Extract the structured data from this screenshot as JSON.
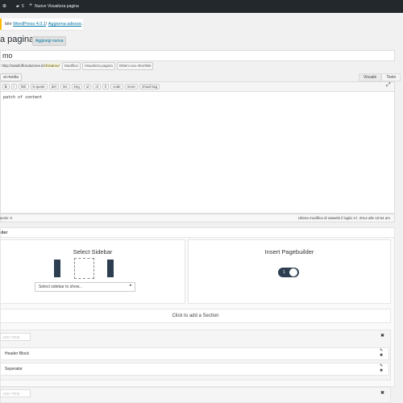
{
  "admin_bar": {
    "comments_count": "5",
    "new_label": "Nuovo",
    "view_page_label": "Visualizza pagina"
  },
  "notice": {
    "prefix": "bile ",
    "link_version": "WordPress 4.0.1",
    "sep": "! ",
    "link_update": "Aggiorna adesso",
    "suffix": "."
  },
  "page": {
    "title": "a pagina",
    "add_new": "Aggiungi nuova"
  },
  "post_title": {
    "value": "mo"
  },
  "permalink": {
    "label": ": http://satulloffondazione.it/",
    "slug": "chisiamo/",
    "buttons": [
      "Modifica",
      "Visualizza pagina",
      "Ottieni uno shortlink"
    ]
  },
  "editor": {
    "add_media": "ai media",
    "tabs": [
      "Visuale",
      "Testo"
    ],
    "quicktags": [
      "b",
      "i",
      "link",
      "b-quote",
      "del",
      "ins",
      "img",
      "ul",
      "ol",
      "li",
      "code",
      "more",
      "chiudi tag"
    ],
    "content": "patch of content",
    "word_count": "arole: 0",
    "last_modified": "Ultima modifica di satwebi il luglio 17, 2014 alle 10:54 am"
  },
  "pagebuilder": {
    "header": "der",
    "select_sidebar_title": "Select Sidebar",
    "select_sidebar_placeholder": "Select sidebar to show...",
    "insert_pagebuilder_title": "Insert Pagebuilder",
    "toggle_value": "1",
    "add_section": "Click to add a Section",
    "section1": {
      "add_item": "ADD ITEM",
      "modules": [
        "Header Block",
        "Seperator"
      ]
    },
    "section2": {
      "add_item": "ADD ITEM"
    }
  },
  "icons": {
    "close": "close-icon",
    "edit": "pencil-icon",
    "remove": "close-icon",
    "fullscreen": "fullscreen-icon",
    "plus": "plus-icon",
    "comment": "comment-icon"
  },
  "colors": {
    "admin_bar": "#23282d",
    "link": "#0074a2",
    "toggle": "#2c3e50",
    "notice_border": "#ffba00"
  }
}
